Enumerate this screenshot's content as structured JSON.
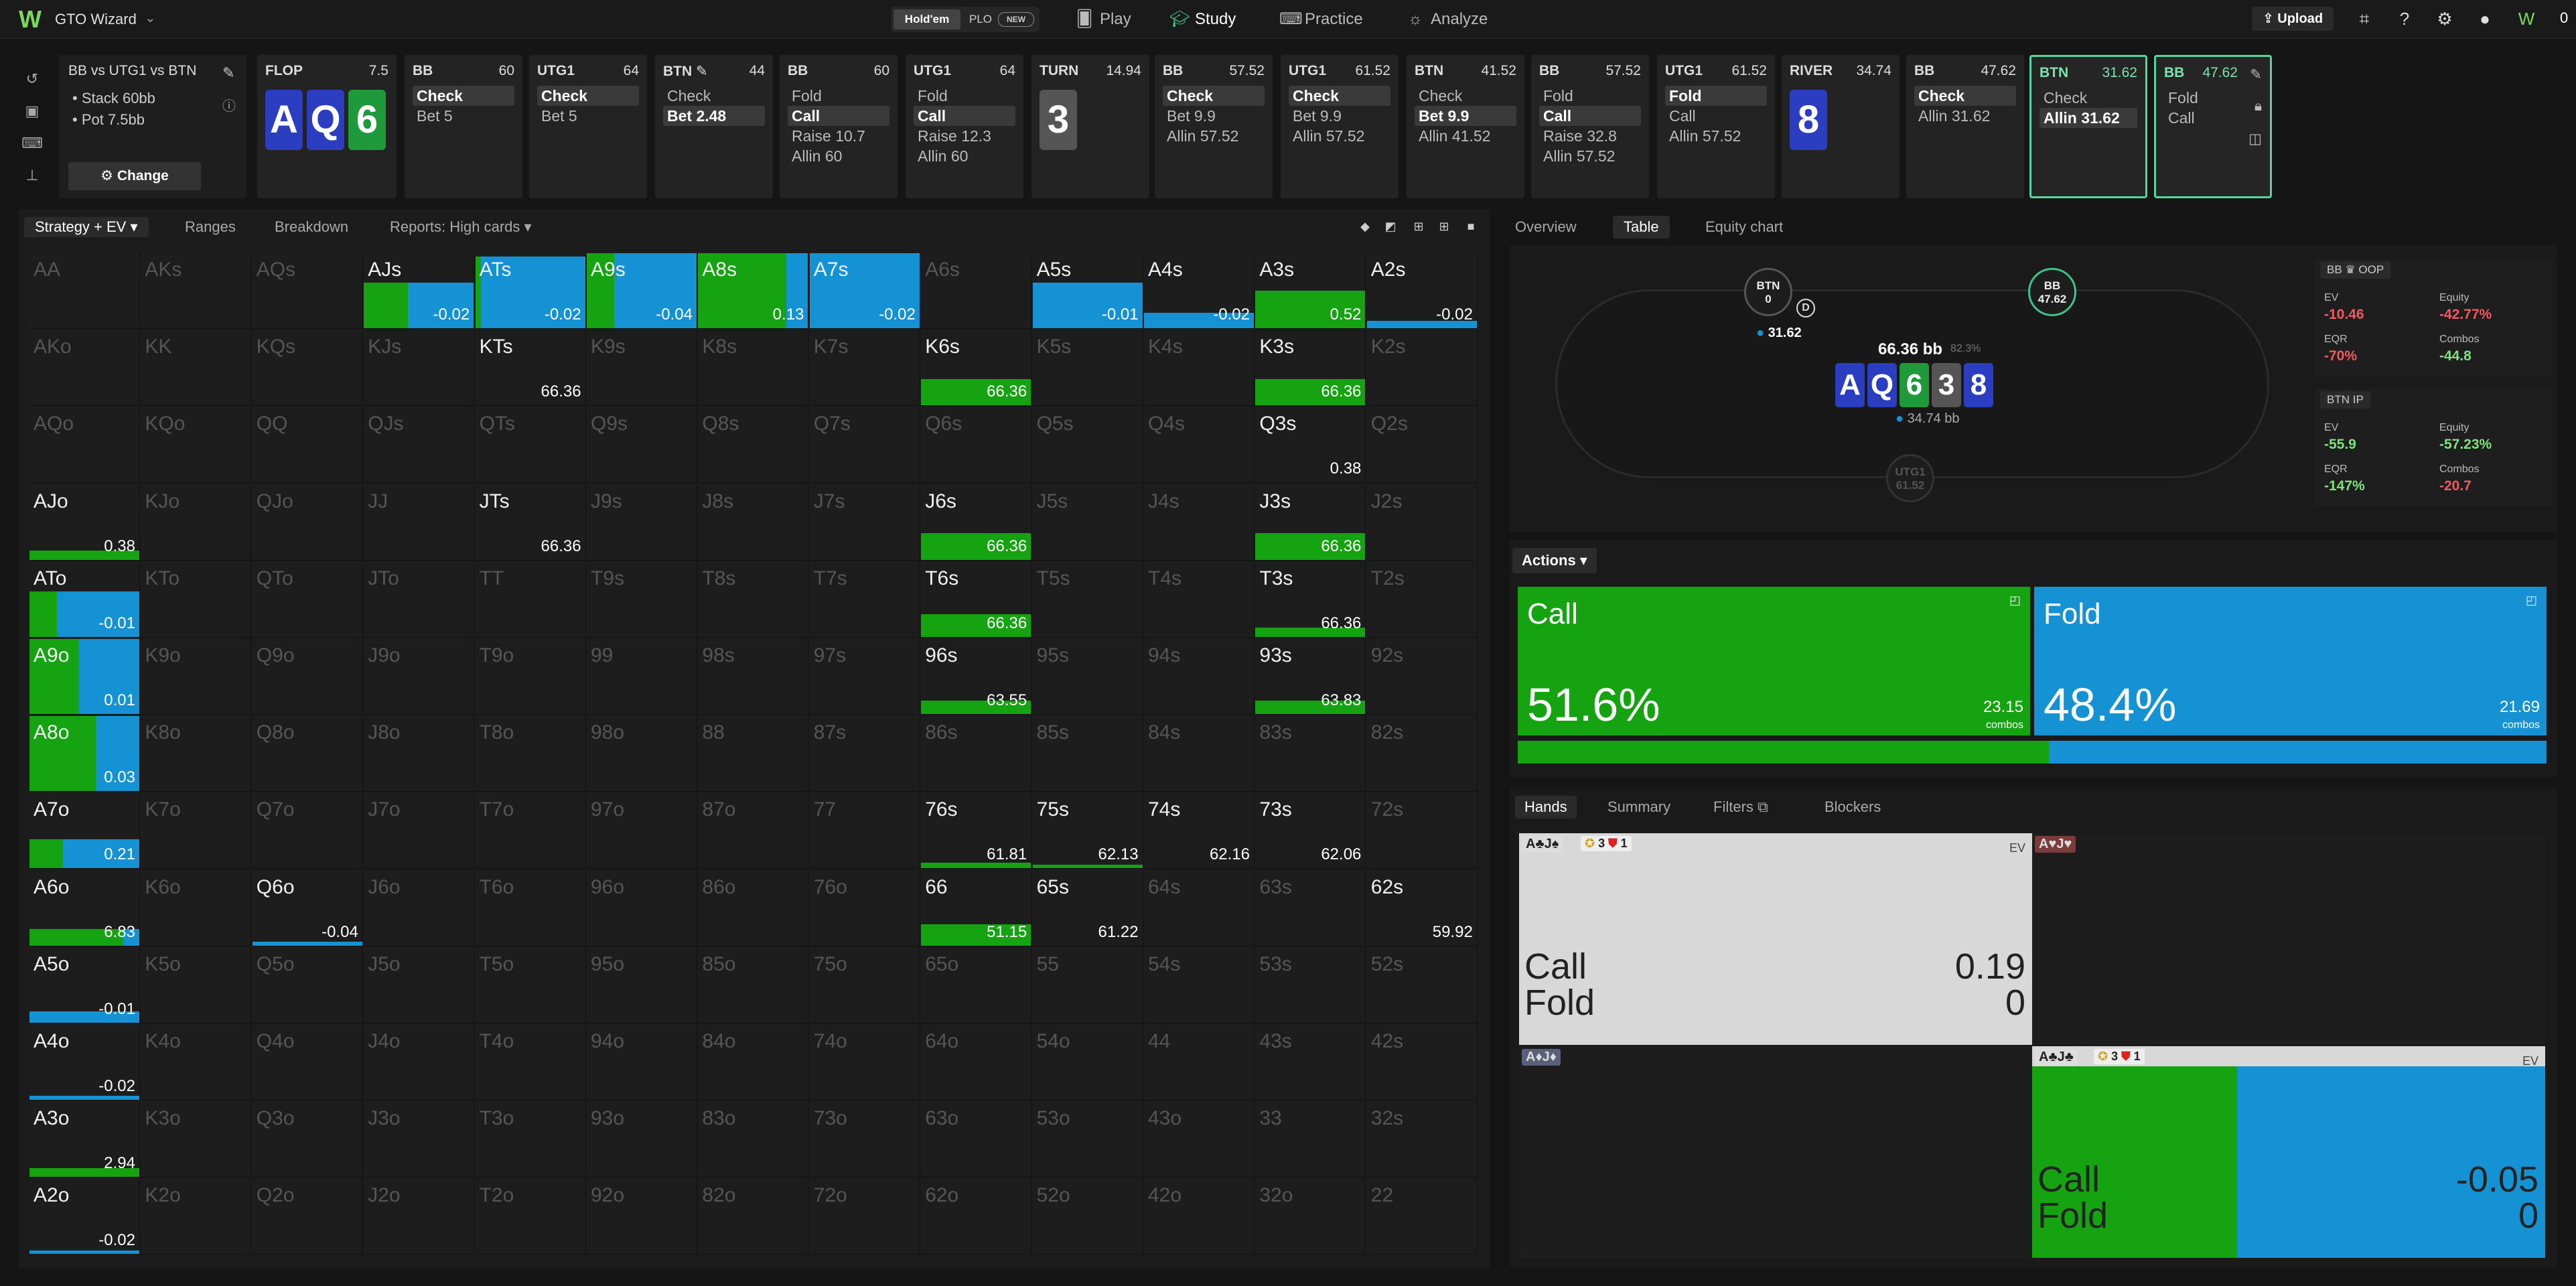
{
  "nav": {
    "brand": "GTO Wizard",
    "holdem": "Hold'em",
    "plo": "PLO",
    "plo_badge": "NEW",
    "play": "Play",
    "study": "Study",
    "practice": "Practice",
    "analyze": "Analyze",
    "upload": "Upload",
    "credits": "0"
  },
  "spot": {
    "title": "BB vs UTG1 vs BTN",
    "stack": "Stack 60bb",
    "pot": "Pot 7.5bb",
    "change": "Change"
  },
  "actions_bar": [
    {
      "head": "FLOP",
      "size": "7.5",
      "cards": [
        "A",
        "Q",
        "6"
      ]
    },
    {
      "head": "BB",
      "size": "60",
      "opts": [
        "Check",
        "Bet 5"
      ],
      "sel": 0
    },
    {
      "head": "UTG1",
      "size": "64",
      "opts": [
        "Check",
        "Bet 5"
      ],
      "sel": 0
    },
    {
      "head": "BTN",
      "size": "44",
      "opts": [
        "Check",
        "Bet 2.48"
      ],
      "sel": 1
    },
    {
      "head": "BB",
      "size": "60",
      "opts": [
        "Fold",
        "Call",
        "Raise 10.7",
        "Allin 60"
      ],
      "sel": 1
    },
    {
      "head": "UTG1",
      "size": "64",
      "opts": [
        "Fold",
        "Call",
        "Raise 12.3",
        "Allin 60"
      ],
      "sel": 1
    },
    {
      "head": "TURN",
      "size": "14.94",
      "cards": [
        "3"
      ]
    },
    {
      "head": "BB",
      "size": "57.52",
      "opts": [
        "Check",
        "Bet 9.9",
        "Allin 57.52"
      ],
      "sel": 0
    },
    {
      "head": "UTG1",
      "size": "61.52",
      "opts": [
        "Check",
        "Bet 9.9",
        "Allin 57.52"
      ],
      "sel": 0
    },
    {
      "head": "BTN",
      "size": "41.52",
      "opts": [
        "Check",
        "Bet 9.9",
        "Allin 41.52"
      ],
      "sel": 1
    },
    {
      "head": "BB",
      "size": "57.52",
      "opts": [
        "Fold",
        "Call",
        "Raise 32.8",
        "Allin 57.52"
      ],
      "sel": 1
    },
    {
      "head": "UTG1",
      "size": "61.52",
      "opts": [
        "Fold",
        "Call",
        "Allin 57.52"
      ],
      "sel": 0
    },
    {
      "head": "RIVER",
      "size": "34.74",
      "cards": [
        "8"
      ]
    },
    {
      "head": "BB",
      "size": "47.62",
      "opts": [
        "Check",
        "Allin 31.62"
      ],
      "sel": 0
    },
    {
      "head": "BTN",
      "size": "31.62",
      "opts": [
        "Check",
        "Allin 31.62"
      ],
      "sel": 1
    },
    {
      "head": "BB",
      "size": "47.62",
      "opts": [
        "Fold",
        "Call"
      ],
      "sel": -1
    }
  ],
  "strategy_tabs": [
    "Strategy + EV",
    "Ranges",
    "Breakdown",
    "Reports: High cards"
  ],
  "grid": [
    [
      [
        "AA",
        0
      ],
      [
        "AKs",
        0
      ],
      [
        "AQs",
        0
      ],
      [
        "AJs",
        1,
        "-0.02",
        0.4,
        0.6
      ],
      [
        "ATs",
        1,
        "-0.02",
        0.05,
        0.95
      ],
      [
        "A9s",
        1,
        "-0.04",
        0.25,
        1
      ],
      [
        "A8s",
        1,
        "0.13",
        0.8,
        1
      ],
      [
        "A7s",
        1,
        "-0.02",
        0,
        1
      ],
      [
        "A6s",
        0
      ],
      [
        "A5s",
        1,
        "-0.01",
        0,
        0.6
      ],
      [
        "A4s",
        1,
        "-0.02",
        0,
        0.2
      ],
      [
        "A3s",
        1,
        "0.52",
        1,
        0.5
      ],
      [
        "A2s",
        1,
        "-0.02",
        0,
        0.1
      ]
    ],
    [
      [
        "AKo",
        0
      ],
      [
        "KK",
        0
      ],
      [
        "KQs",
        0
      ],
      [
        "KJs",
        0
      ],
      [
        "KTs",
        1,
        "66.36",
        0,
        0
      ],
      [
        "K9s",
        0
      ],
      [
        "K8s",
        0
      ],
      [
        "K7s",
        0
      ],
      [
        "K6s",
        1,
        "66.36",
        1,
        0.35
      ],
      [
        "K5s",
        0
      ],
      [
        "K4s",
        0
      ],
      [
        "K3s",
        1,
        "66.36",
        1,
        0.35
      ],
      [
        "K2s",
        0
      ]
    ],
    [
      [
        "AQo",
        0
      ],
      [
        "KQo",
        0
      ],
      [
        "QQ",
        0
      ],
      [
        "QJs",
        0
      ],
      [
        "QTs",
        0
      ],
      [
        "Q9s",
        0
      ],
      [
        "Q8s",
        0
      ],
      [
        "Q7s",
        0
      ],
      [
        "Q6s",
        0
      ],
      [
        "Q5s",
        0
      ],
      [
        "Q4s",
        0
      ],
      [
        "Q3s",
        1,
        "0.38",
        0,
        0
      ],
      [
        "Q2s",
        0
      ]
    ],
    [
      [
        "AJo",
        1,
        "0.38",
        1,
        0.12
      ],
      [
        "KJo",
        0
      ],
      [
        "QJo",
        0
      ],
      [
        "JJ",
        0
      ],
      [
        "JTs",
        1,
        "66.36",
        0,
        0
      ],
      [
        "J9s",
        0
      ],
      [
        "J8s",
        0
      ],
      [
        "J7s",
        0
      ],
      [
        "J6s",
        1,
        "66.36",
        1,
        0.35
      ],
      [
        "J5s",
        0
      ],
      [
        "J4s",
        0
      ],
      [
        "J3s",
        1,
        "66.36",
        1,
        0.35
      ],
      [
        "J2s",
        0
      ]
    ],
    [
      [
        "ATo",
        1,
        "-0.01",
        0.25,
        0.6
      ],
      [
        "KTo",
        0
      ],
      [
        "QTo",
        0
      ],
      [
        "JTo",
        0
      ],
      [
        "TT",
        0
      ],
      [
        "T9s",
        0
      ],
      [
        "T8s",
        0
      ],
      [
        "T7s",
        0
      ],
      [
        "T6s",
        1,
        "66.36",
        1,
        0.3
      ],
      [
        "T5s",
        0
      ],
      [
        "T4s",
        0
      ],
      [
        "T3s",
        1,
        "66.36",
        1,
        0.12
      ],
      [
        "T2s",
        0
      ]
    ],
    [
      [
        "A9o",
        1,
        "0.01",
        0.45,
        1
      ],
      [
        "K9o",
        0
      ],
      [
        "Q9o",
        0
      ],
      [
        "J9o",
        0
      ],
      [
        "T9o",
        0
      ],
      [
        "99",
        0
      ],
      [
        "98s",
        0
      ],
      [
        "97s",
        0
      ],
      [
        "96s",
        1,
        "63.55",
        1,
        0.18
      ],
      [
        "95s",
        0
      ],
      [
        "94s",
        0
      ],
      [
        "93s",
        1,
        "63.83",
        1,
        0.18
      ],
      [
        "92s",
        0
      ]
    ],
    [
      [
        "A8o",
        1,
        "0.03",
        0.6,
        1
      ],
      [
        "K8o",
        0
      ],
      [
        "Q8o",
        0
      ],
      [
        "J8o",
        0
      ],
      [
        "T8o",
        0
      ],
      [
        "98o",
        0
      ],
      [
        "88",
        0
      ],
      [
        "87s",
        0
      ],
      [
        "86s",
        0
      ],
      [
        "85s",
        0
      ],
      [
        "84s",
        0
      ],
      [
        "83s",
        0
      ],
      [
        "82s",
        0
      ]
    ],
    [
      [
        "A7o",
        1,
        "0.21",
        0.3,
        0.38
      ],
      [
        "K7o",
        0
      ],
      [
        "Q7o",
        0
      ],
      [
        "J7o",
        0
      ],
      [
        "T7o",
        0
      ],
      [
        "97o",
        0
      ],
      [
        "87o",
        0
      ],
      [
        "77",
        0
      ],
      [
        "76s",
        1,
        "61.81",
        1,
        0.07
      ],
      [
        "75s",
        1,
        "62.13",
        1,
        0.05
      ],
      [
        "74s",
        1,
        "62.16",
        0,
        0
      ],
      [
        "73s",
        1,
        "62.06",
        0,
        0
      ],
      [
        "72s",
        0
      ]
    ],
    [
      [
        "A6o",
        1,
        "6.83",
        0.85,
        0.22
      ],
      [
        "K6o",
        0
      ],
      [
        "Q6o",
        1,
        "-0.04",
        0,
        0.05
      ],
      [
        "J6o",
        0
      ],
      [
        "T6o",
        0
      ],
      [
        "96o",
        0
      ],
      [
        "86o",
        0
      ],
      [
        "76o",
        0
      ],
      [
        "66",
        1,
        "51.15",
        1,
        0.28
      ],
      [
        "65s",
        1,
        "61.22",
        0,
        0
      ],
      [
        "64s",
        0
      ],
      [
        "63s",
        0
      ],
      [
        "62s",
        1,
        "59.92",
        0,
        0
      ]
    ],
    [
      [
        "A5o",
        1,
        "-0.01",
        0,
        0.15
      ],
      [
        "K5o",
        0
      ],
      [
        "Q5o",
        0
      ],
      [
        "J5o",
        0
      ],
      [
        "T5o",
        0
      ],
      [
        "95o",
        0
      ],
      [
        "85o",
        0
      ],
      [
        "75o",
        0
      ],
      [
        "65o",
        0
      ],
      [
        "55",
        0
      ],
      [
        "54s",
        0
      ],
      [
        "53s",
        0
      ],
      [
        "52s",
        0
      ]
    ],
    [
      [
        "A4o",
        1,
        "-0.02",
        0,
        0.05
      ],
      [
        "K4o",
        0
      ],
      [
        "Q4o",
        0
      ],
      [
        "J4o",
        0
      ],
      [
        "T4o",
        0
      ],
      [
        "94o",
        0
      ],
      [
        "84o",
        0
      ],
      [
        "74o",
        0
      ],
      [
        "64o",
        0
      ],
      [
        "54o",
        0
      ],
      [
        "44",
        0
      ],
      [
        "43s",
        0
      ],
      [
        "42s",
        0
      ]
    ],
    [
      [
        "A3o",
        1,
        "2.94",
        1,
        0.12
      ],
      [
        "K3o",
        0
      ],
      [
        "Q3o",
        0
      ],
      [
        "J3o",
        0
      ],
      [
        "T3o",
        0
      ],
      [
        "93o",
        0
      ],
      [
        "83o",
        0
      ],
      [
        "73o",
        0
      ],
      [
        "63o",
        0
      ],
      [
        "53o",
        0
      ],
      [
        "43o",
        0
      ],
      [
        "33",
        0
      ],
      [
        "32s",
        0
      ]
    ],
    [
      [
        "A2o",
        1,
        "-0.02",
        0,
        0.05
      ],
      [
        "K2o",
        0
      ],
      [
        "Q2o",
        0
      ],
      [
        "J2o",
        0
      ],
      [
        "T2o",
        0
      ],
      [
        "92o",
        0
      ],
      [
        "82o",
        0
      ],
      [
        "72o",
        0
      ],
      [
        "62o",
        0
      ],
      [
        "52o",
        0
      ],
      [
        "42o",
        0
      ],
      [
        "32o",
        0
      ],
      [
        "22",
        0
      ]
    ]
  ],
  "right_tabs": [
    "Overview",
    "Table",
    "Equity chart"
  ],
  "table": {
    "btn_label": "BTN",
    "btn_stack": "0",
    "bb_label": "BB",
    "bb_stack": "47.62",
    "utg_label": "UTG1",
    "utg_stack": "61.52",
    "chip": "31.62",
    "pot": "66.36 bb",
    "pot_pct": "82.3%",
    "board": [
      "A",
      "Q",
      "6",
      "3",
      "8"
    ],
    "stack_line": "34.74 bb"
  },
  "stats_bb": {
    "hdr": "BB",
    "pos": "OOP",
    "ev": "-10.46",
    "equity": "-42.77%",
    "eqr": "-70%",
    "combos": "-44.8"
  },
  "stats_btn": {
    "hdr": "BTN",
    "pos": "IP",
    "ev": "-55.9",
    "equity": "-57.23%",
    "eqr": "-147%",
    "combos": "-20.7"
  },
  "stat_labels": {
    "ev": "EV",
    "equity": "Equity",
    "eqr": "EQR",
    "combos": "Combos"
  },
  "actions_label": "Actions",
  "action_call": {
    "name": "Call",
    "pct": "51.6%",
    "combos": "23.15",
    "unit": "combos",
    "frac": 0.516
  },
  "action_fold": {
    "name": "Fold",
    "pct": "48.4%",
    "combos": "21.69",
    "unit": "combos",
    "frac": 0.484
  },
  "hands_tabs": [
    "Hands",
    "Summary",
    "Filters",
    "Blockers"
  ],
  "hands": [
    {
      "tag": "A♣J♠",
      "tag2": "3 1",
      "ev": "EV",
      "call": "Call",
      "fold": "Fold",
      "cv": "0.19",
      "fv": "0",
      "style": "light"
    },
    {
      "tag": "A♥J♥",
      "style": "empty"
    },
    {
      "tag": "A♦J♦",
      "style": "empty"
    },
    {
      "tag": "A♣J♣",
      "tag2": "3 1",
      "ev": "EV",
      "call": "Call",
      "fold": "Fold",
      "cv": "-0.05",
      "fv": "0",
      "style": "split",
      "callfrac": 0.4
    }
  ],
  "colors": {
    "call": "#15a312",
    "fold": "#1592d3",
    "accent": "#3fc38a"
  }
}
